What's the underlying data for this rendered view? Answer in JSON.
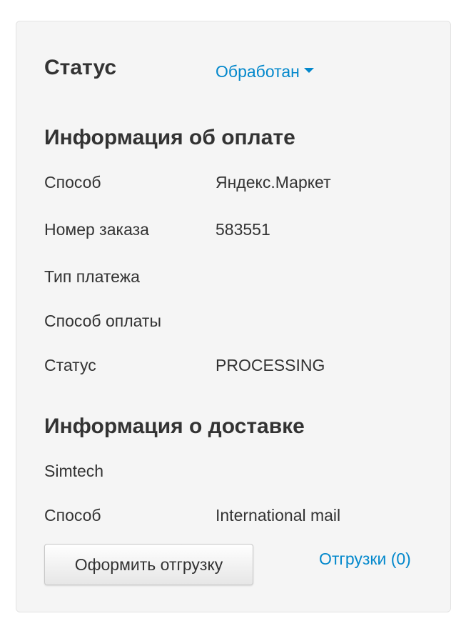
{
  "status": {
    "title": "Статус",
    "current_value": "Обработан"
  },
  "payment_info": {
    "title": "Информация об оплате",
    "rows": [
      {
        "label": "Способ",
        "value": "Яндекс.Маркет"
      },
      {
        "label": "Номер заказа",
        "value": "583551"
      },
      {
        "label": "Тип платежа",
        "value": ""
      },
      {
        "label": "Способ оплаты",
        "value": ""
      },
      {
        "label": "Статус",
        "value": "PROCESSING"
      }
    ]
  },
  "shipping_info": {
    "title": "Информация о доставке",
    "carrier": "Simtech",
    "method_label": "Способ",
    "method_value": "International mail"
  },
  "actions": {
    "create_shipment_label": "Оформить отгрузку",
    "shipments_link_label": "Отгрузки (0)"
  },
  "colors": {
    "link": "#0388cc",
    "panel_bg": "#f5f5f5",
    "text": "#333333"
  }
}
